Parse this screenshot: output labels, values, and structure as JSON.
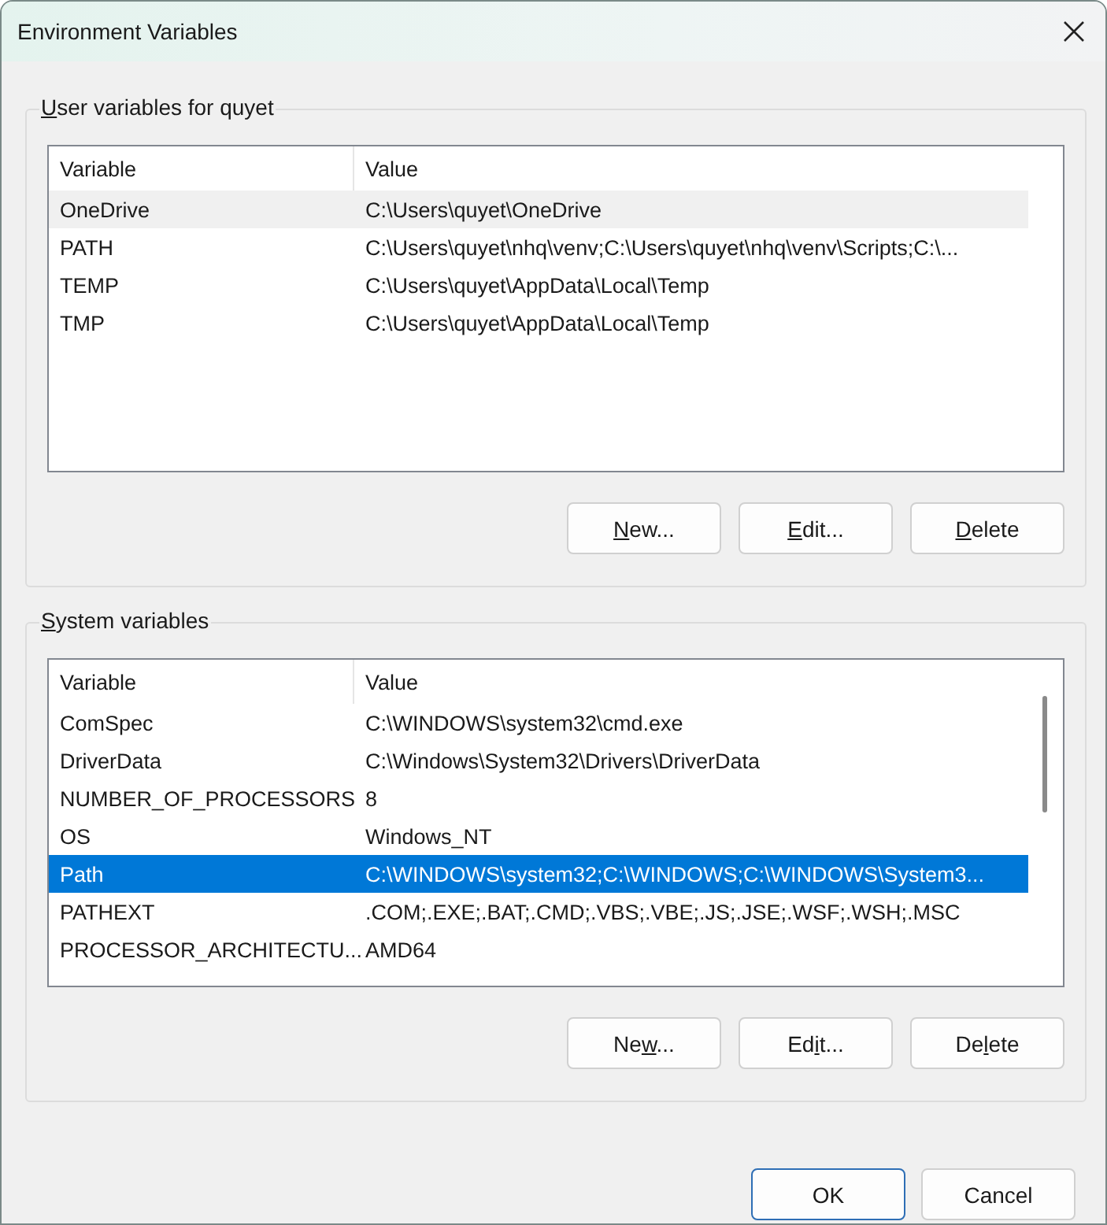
{
  "window": {
    "title": "Environment Variables"
  },
  "user_variables": {
    "access_key": "U",
    "label_post": "ser variables for quyet",
    "columns": [
      "Variable",
      "Value"
    ],
    "rows": [
      {
        "variable": "OneDrive",
        "value": "C:\\Users\\quyet\\OneDrive",
        "selected": false,
        "hovered": true
      },
      {
        "variable": "PATH",
        "value": "C:\\Users\\quyet\\nhq\\venv;C:\\Users\\quyet\\nhq\\venv\\Scripts;C:\\...",
        "selected": false,
        "hovered": false
      },
      {
        "variable": "TEMP",
        "value": "C:\\Users\\quyet\\AppData\\Local\\Temp",
        "selected": false,
        "hovered": false
      },
      {
        "variable": "TMP",
        "value": "C:\\Users\\quyet\\AppData\\Local\\Temp",
        "selected": false,
        "hovered": false
      }
    ],
    "buttons": [
      {
        "access_key": "N",
        "label_post": "ew..."
      },
      {
        "access_key": "E",
        "label_post": "dit..."
      },
      {
        "access_key": "D",
        "label_post": "elete"
      }
    ]
  },
  "system_variables": {
    "access_key": "S",
    "label_post": "ystem variables",
    "columns": [
      "Variable",
      "Value"
    ],
    "rows": [
      {
        "variable": "ComSpec",
        "value": "C:\\WINDOWS\\system32\\cmd.exe",
        "selected": false,
        "hovered": false
      },
      {
        "variable": "DriverData",
        "value": "C:\\Windows\\System32\\Drivers\\DriverData",
        "selected": false,
        "hovered": false
      },
      {
        "variable": "NUMBER_OF_PROCESSORS",
        "value": "8",
        "selected": false,
        "hovered": false
      },
      {
        "variable": "OS",
        "value": "Windows_NT",
        "selected": false,
        "hovered": false
      },
      {
        "variable": "Path",
        "value": "C:\\WINDOWS\\system32;C:\\WINDOWS;C:\\WINDOWS\\System3...",
        "selected": true,
        "hovered": false
      },
      {
        "variable": "PATHEXT",
        "value": ".COM;.EXE;.BAT;.CMD;.VBS;.VBE;.JS;.JSE;.WSF;.WSH;.MSC",
        "selected": false,
        "hovered": false
      },
      {
        "variable": "PROCESSOR_ARCHITECTU...",
        "value": "AMD64",
        "selected": false,
        "hovered": false
      }
    ],
    "buttons": [
      {
        "label_pre": "Ne",
        "access_key": "w",
        "label_post": "..."
      },
      {
        "label_pre": "Ed",
        "access_key": "i",
        "label_post": "t..."
      },
      {
        "label_pre": "De",
        "access_key": "l",
        "label_post": "ete"
      }
    ]
  },
  "dialog_buttons": [
    {
      "label": "OK",
      "default": true
    },
    {
      "label": "Cancel",
      "default": false
    }
  ]
}
